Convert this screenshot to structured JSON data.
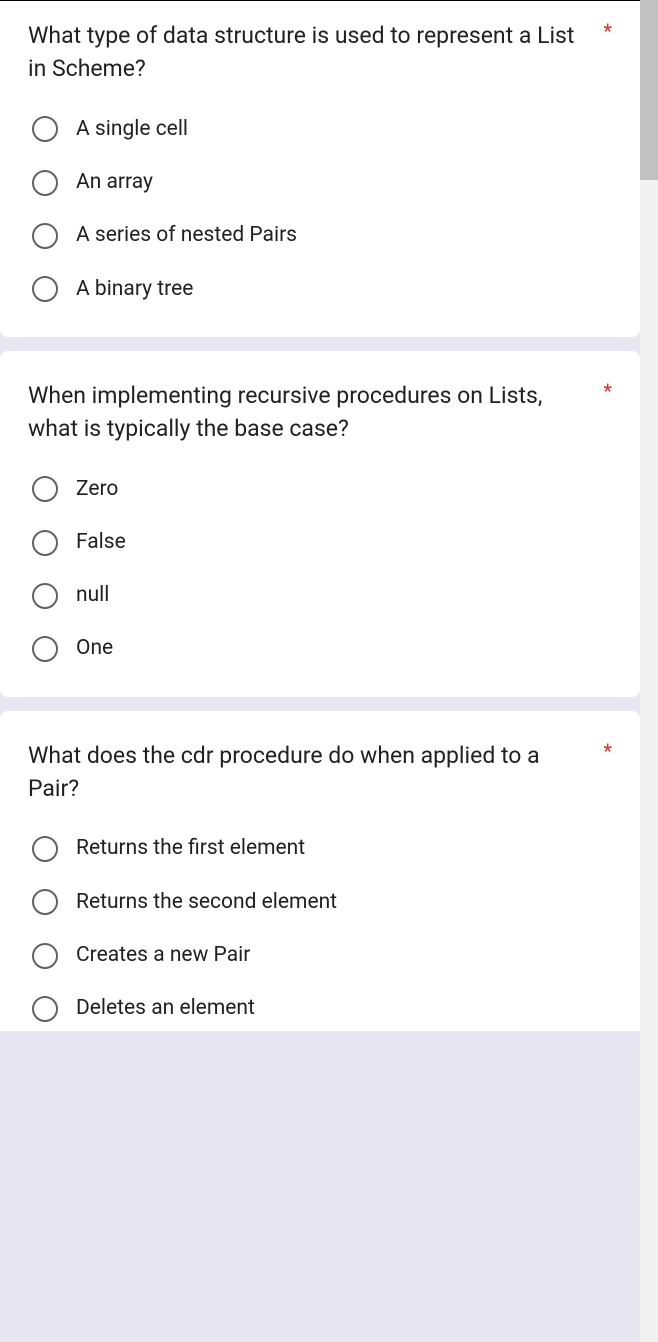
{
  "questions": [
    {
      "text": "What type of data structure is used to represent a List in Scheme?",
      "required": "*",
      "options": [
        "A single cell",
        "An array",
        "A series of nested Pairs",
        "A binary tree"
      ]
    },
    {
      "text": "When implementing recursive procedures on Lists, what is typically the base case?",
      "required": "*",
      "options": [
        "Zero",
        "False",
        "null",
        "One"
      ]
    },
    {
      "text": "What does the cdr procedure do when applied to a Pair?",
      "required": "*",
      "options": [
        "Returns the first element",
        "Returns the second element",
        "Creates a new Pair",
        "Deletes an element"
      ]
    }
  ]
}
